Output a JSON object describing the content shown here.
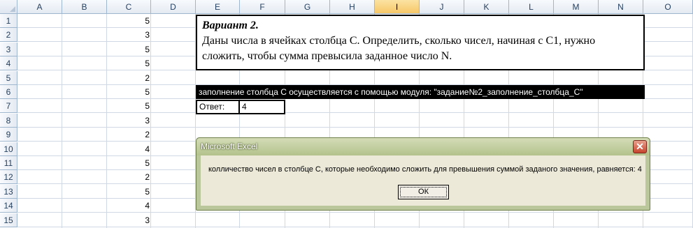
{
  "columns": [
    "A",
    "B",
    "C",
    "D",
    "E",
    "F",
    "G",
    "H",
    "I",
    "J",
    "K",
    "L",
    "M",
    "N",
    "O"
  ],
  "selected_column": "I",
  "rows": [
    "1",
    "2",
    "3",
    "4",
    "5",
    "6",
    "7",
    "8",
    "9",
    "10",
    "11",
    "12",
    "13",
    "14",
    "15"
  ],
  "column_c_values": [
    "5",
    "3",
    "5",
    "5",
    "2",
    "5",
    "5",
    "3",
    "2",
    "4",
    "5",
    "2",
    "5",
    "4",
    "3"
  ],
  "task": {
    "title": "Вариант 2.",
    "text": "Даны числа в ячейках столбца С. Определить, сколько чисел, начиная с С1, нужно сложить, чтобы сумма превысила заданное число N."
  },
  "info_bar": "заполнение столбца С осуществляется с помощью модуля: \"задание№2_заполнение_столбца_С\"",
  "answer": {
    "label": "Ответ:",
    "value": "4"
  },
  "dialog": {
    "title": "Microsoft Excel",
    "close_label": "✕",
    "message": "колличество чисел в столбце С, которые необходимо сложить для превышения суммой заданого значения, равняется:  4",
    "ok_label": "ОК"
  }
}
